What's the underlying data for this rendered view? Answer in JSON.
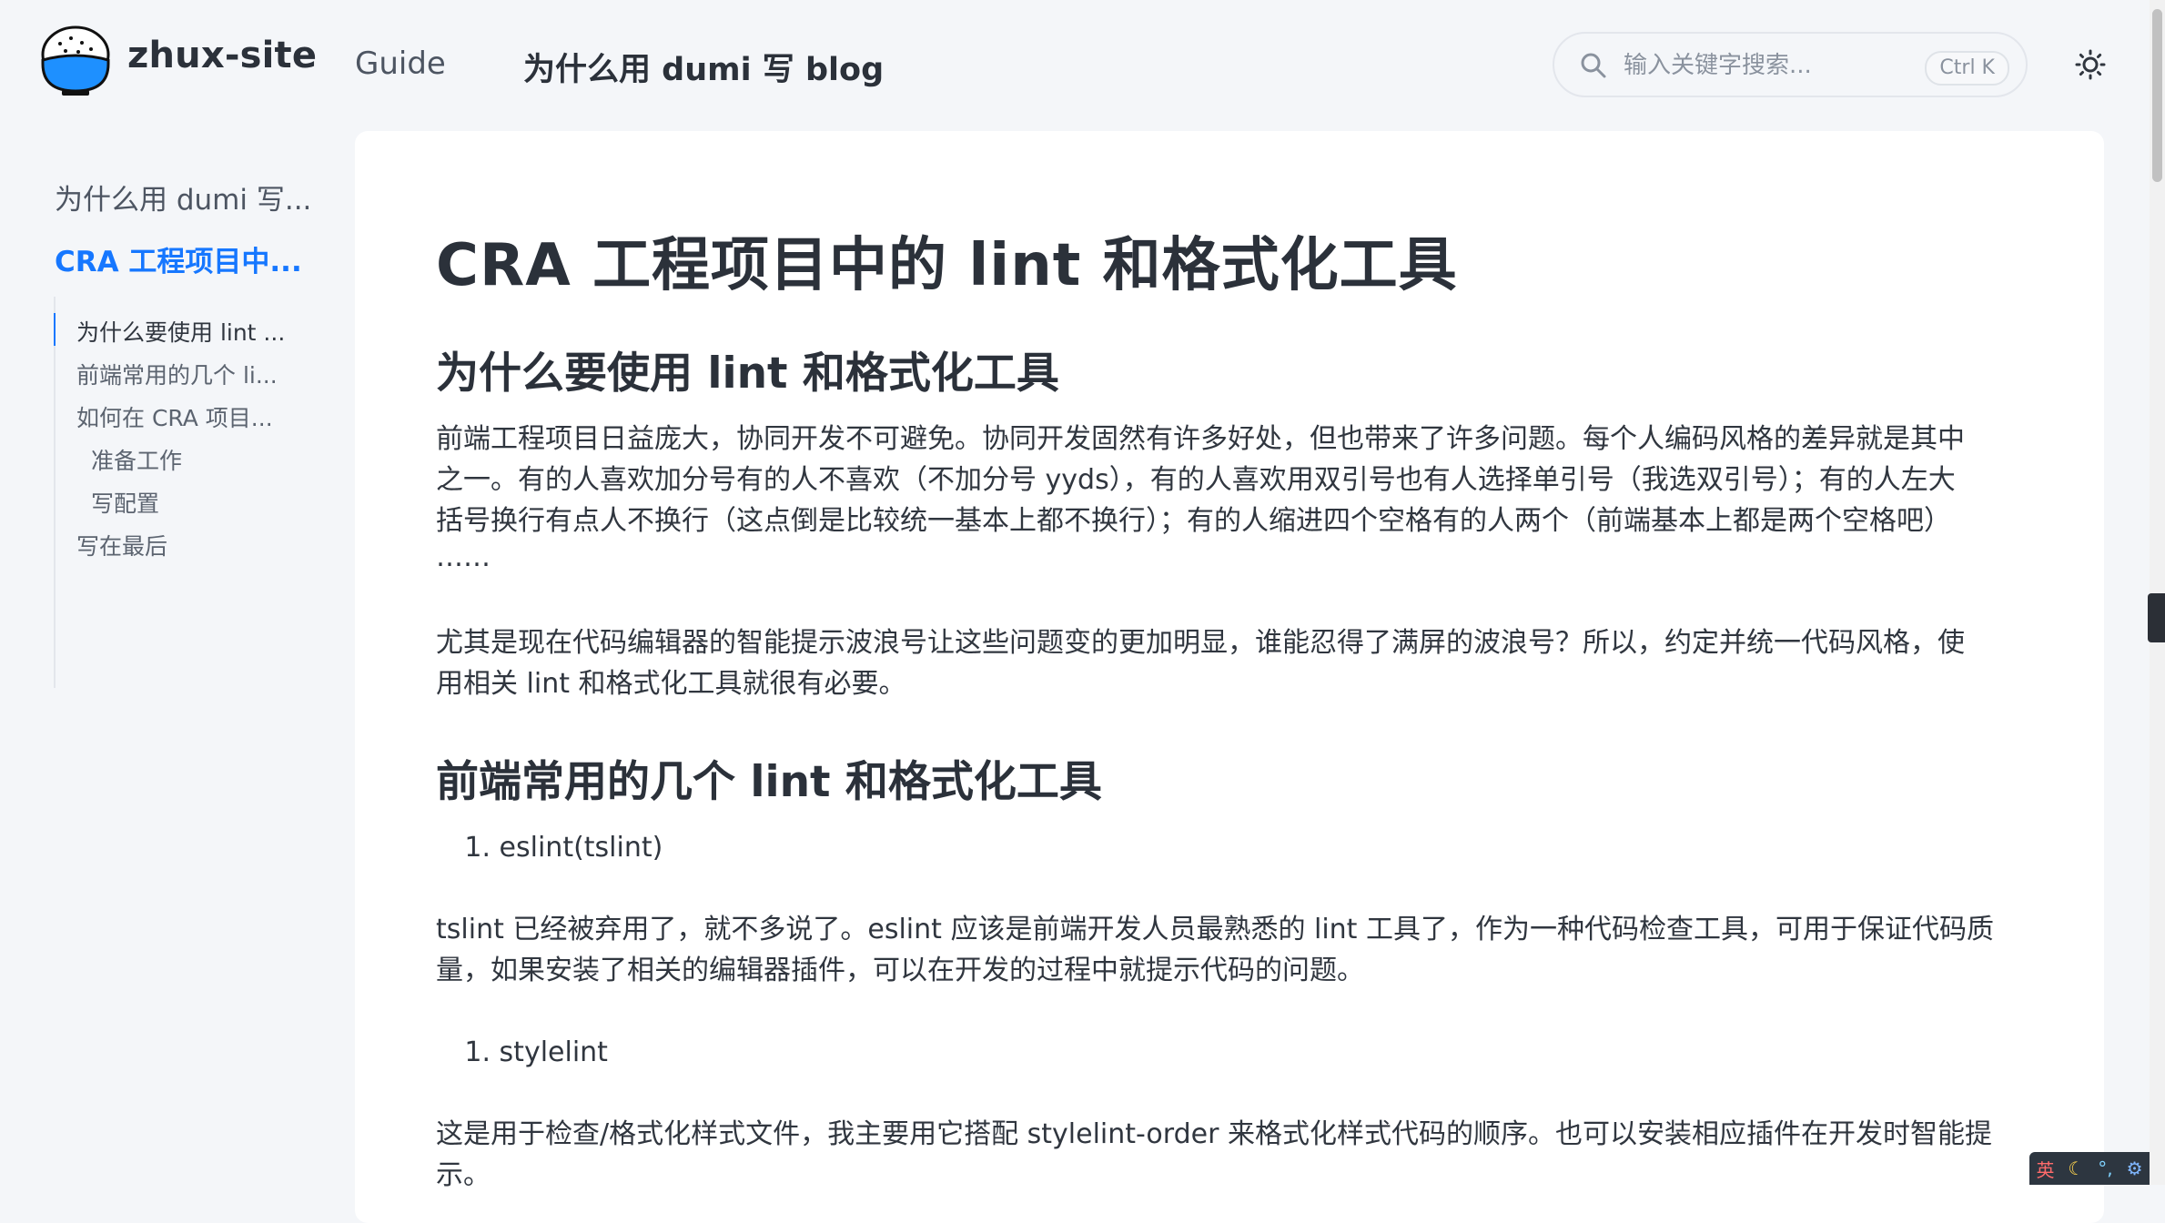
{
  "header": {
    "site_title": "zhux-site",
    "nav": {
      "guide": "Guide",
      "blog": "为什么用 dumi 写 blog"
    },
    "search": {
      "placeholder": "输入关键字搜索...",
      "shortcut": "Ctrl K"
    }
  },
  "sidebar": {
    "links": [
      "为什么用 dumi 写...",
      "CRA 工程项目中..."
    ],
    "toc": [
      "为什么要使用 lint ...",
      "前端常用的几个 li...",
      "如何在 CRA 项目...",
      "准备工作",
      "写配置",
      "写在最后"
    ]
  },
  "article": {
    "title": "CRA 工程项目中的 lint 和格式化工具",
    "h2_1": "为什么要使用 lint 和格式化工具",
    "p1_1": "前端工程项目日益庞大，协同开发不可避免。协同开发固然有许多好处，但也带来了许多问题。每个人编码风格的差异就是其中",
    "p1_2": "之一。有的人喜欢加分号有的人不喜欢（不加分号 yyds），有的人喜欢用双引号也有人选择单引号（我选双引号）；有的人左大",
    "p1_3": "括号换行有点人不换行（这点倒是比较统一基本上都不换行）；有的人缩进四个空格有的人两个（前端基本上都是两个空格吧）",
    "p1_4": "……",
    "p2_1": "尤其是现在代码编辑器的智能提示波浪号让这些问题变的更加明显，谁能忍得了满屏的波浪号？所以，约定并统一代码风格，使",
    "p2_2": "用相关 lint 和格式化工具就很有必要。",
    "h2_2": "前端常用的几个 lint 和格式化工具",
    "li1_num": "1.",
    "li1": "eslint(tslint)",
    "p3_1": "tslint 已经被弃用了，就不多说了。eslint 应该是前端开发人员最熟悉的 lint 工具了，作为一种代码检查工具，可用于保证代码质",
    "p3_2": "量，如果安装了相关的编辑器插件，可以在开发的过程中就提示代码的问题。",
    "li2_num": "1.",
    "li2": "stylelint",
    "p4_1": "这是用于检查/格式化样式文件，我主要用它搭配 stylelint-order 来格式化样式代码的顺序。也可以安装相应插件在开发时智能提",
    "p4_2": "示。"
  },
  "ime": {
    "lang": "英",
    "moon": "☾",
    "dots": "°,",
    "gear": "⚙"
  },
  "colors": {
    "accent": "#1677ff",
    "background": "#f4f6f9",
    "card": "#ffffff",
    "text": "#30363f"
  }
}
